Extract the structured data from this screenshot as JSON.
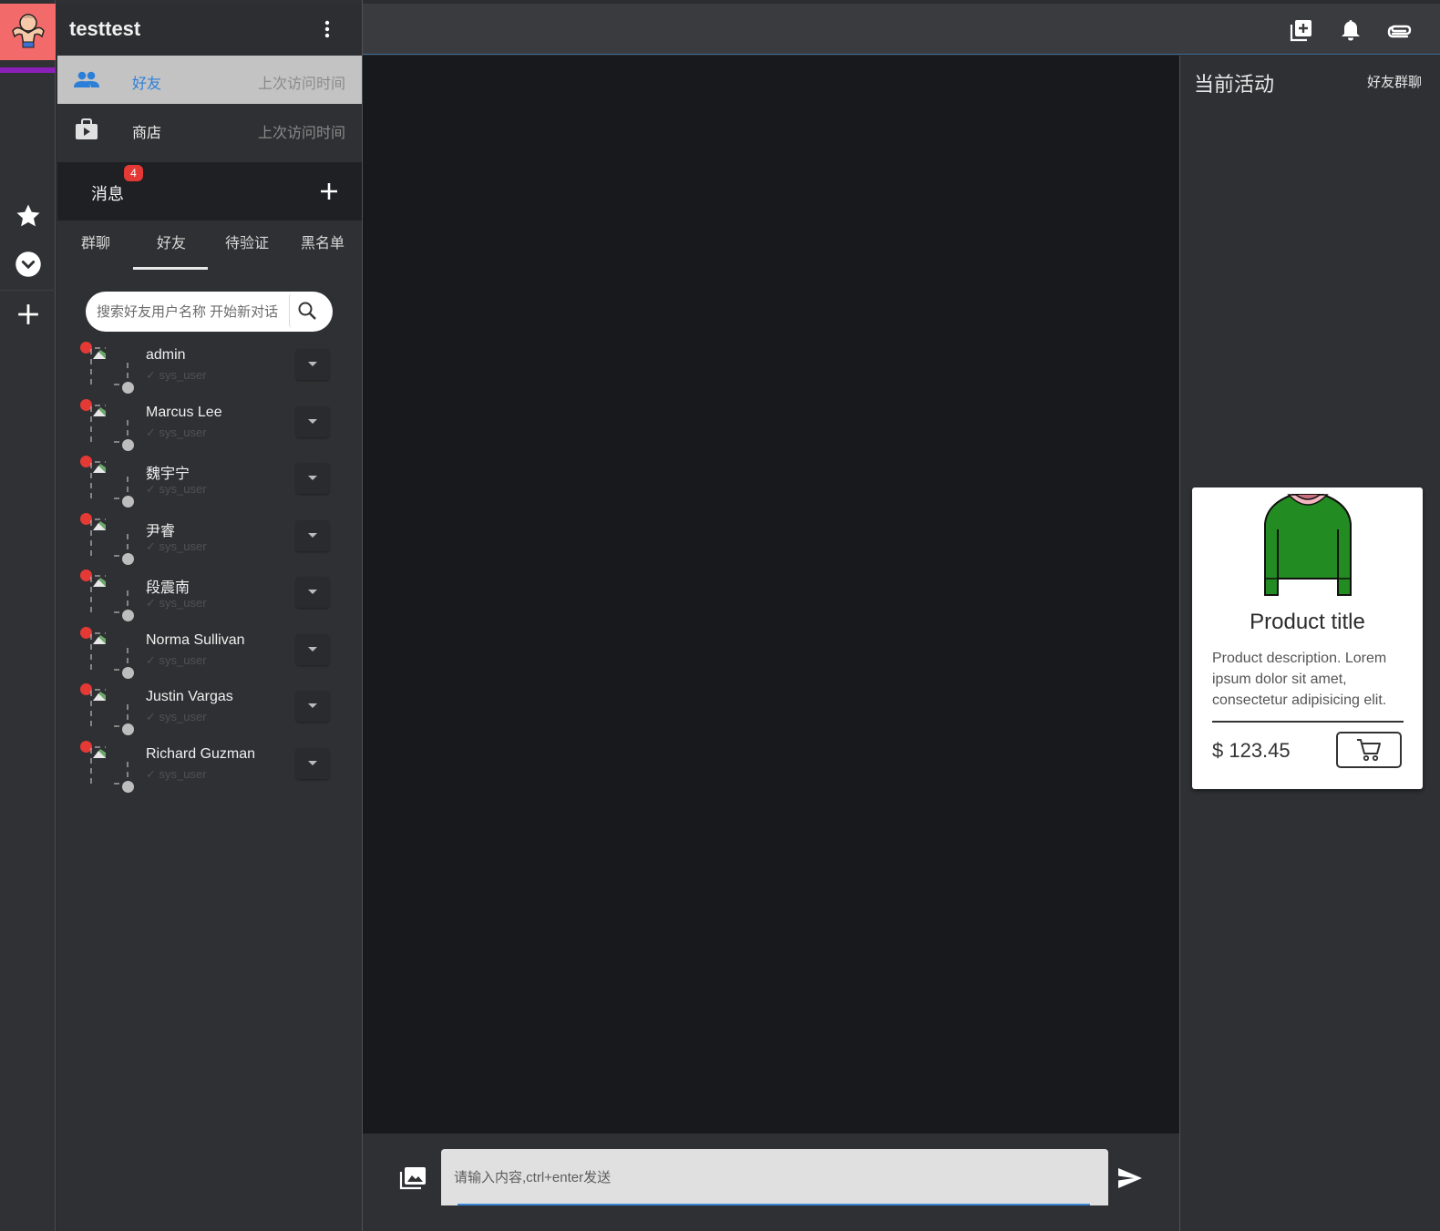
{
  "app": {
    "username": "testtest"
  },
  "rail": {
    "items": [
      "favorites-icon",
      "expand-icon",
      "add-icon"
    ]
  },
  "nav": [
    {
      "label": "好友",
      "meta": "上次访问时间",
      "icon": "people-icon"
    },
    {
      "label": "商店",
      "meta": "上次访问时间",
      "icon": "shop-icon"
    }
  ],
  "messages": {
    "label": "消息",
    "badge": "4"
  },
  "tabs": [
    {
      "label": "群聊"
    },
    {
      "label": "好友",
      "active": true
    },
    {
      "label": "待验证"
    },
    {
      "label": "黑名单"
    }
  ],
  "search": {
    "placeholder": "搜索好友用户名称 开始新对话"
  },
  "friends": [
    {
      "name": "admin",
      "sub": "✓ sys_user"
    },
    {
      "name": "Marcus Lee",
      "sub": "✓ sys_user"
    },
    {
      "name": "魏宇宁",
      "sub": "✓ sys_user"
    },
    {
      "name": "尹睿",
      "sub": "✓ sys_user"
    },
    {
      "name": "段震南",
      "sub": "✓ sys_user"
    },
    {
      "name": "Norma Sullivan",
      "sub": "✓ sys_user"
    },
    {
      "name": "Justin Vargas",
      "sub": "✓ sys_user"
    },
    {
      "name": "Richard Guzman",
      "sub": "✓ sys_user"
    }
  ],
  "composer": {
    "placeholder": "请输入内容,ctrl+enter发送"
  },
  "right": {
    "title": "当前活动",
    "link": "好友群聊",
    "product": {
      "title": "Product title",
      "description": "Product description. Lorem ipsum dolor sit amet, consectetur adipisicing elit.",
      "price": "$ 123.45"
    }
  },
  "colors": {
    "accent": "#2c7fd8",
    "badge": "#e53935",
    "logo_bg": "#f36a6a",
    "logo_bar": "#8b20b8",
    "sweater": "#228b22"
  }
}
